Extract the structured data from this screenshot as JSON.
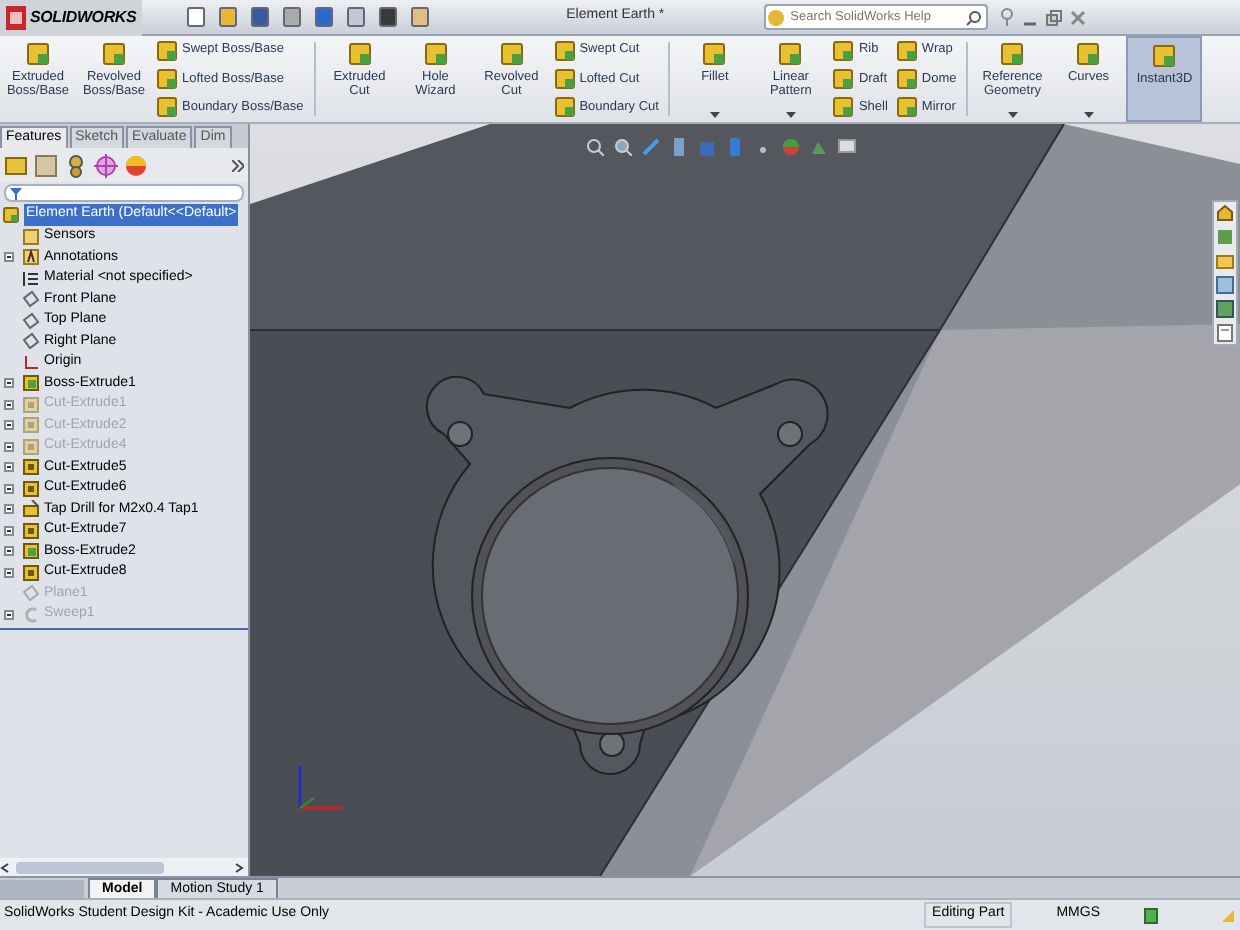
{
  "window": {
    "app": "SOLIDWORKS",
    "title": "Element Earth *"
  },
  "help_search": {
    "placeholder": "Search SolidWorks Help"
  },
  "ribbon": [
    {
      "kind": "large",
      "label": "Extruded Boss/Base"
    },
    {
      "kind": "large",
      "label": "Revolved Boss/Base"
    },
    {
      "kind": "stack",
      "items": [
        "Swept Boss/Base",
        "Lofted Boss/Base",
        "Boundary Boss/Base"
      ]
    },
    {
      "kind": "separator"
    },
    {
      "kind": "large",
      "label": "Extruded Cut"
    },
    {
      "kind": "large",
      "label": "Hole Wizard"
    },
    {
      "kind": "large",
      "label": "Revolved Cut"
    },
    {
      "kind": "stack",
      "items": [
        "Swept Cut",
        "Lofted Cut",
        "Boundary Cut"
      ]
    },
    {
      "kind": "separator"
    },
    {
      "kind": "large",
      "label": "Fillet",
      "dropdown": true
    },
    {
      "kind": "large",
      "label": "Linear Pattern",
      "dropdown": true
    },
    {
      "kind": "stack",
      "items": [
        "Rib",
        "Draft",
        "Shell"
      ]
    },
    {
      "kind": "stack",
      "items": [
        "Wrap",
        "Dome",
        "Mirror"
      ]
    },
    {
      "kind": "separator"
    },
    {
      "kind": "large",
      "label": "Reference Geometry",
      "dropdown": true
    },
    {
      "kind": "large",
      "label": "Curves",
      "dropdown": true
    },
    {
      "kind": "large",
      "label": "Instant3D",
      "selected": true
    }
  ],
  "tabs": [
    {
      "label": "Features",
      "selected": true
    },
    {
      "label": "Sketch",
      "selected": false
    },
    {
      "label": "Evaluate",
      "selected": false
    },
    {
      "label": "Dim",
      "selected": false
    }
  ],
  "tree": {
    "root": {
      "label": "Element Earth  (Default<<Default>",
      "selected": true
    },
    "items": [
      {
        "label": "Sensors",
        "kind": "sensor",
        "expandable": false,
        "suppressed": false
      },
      {
        "label": "Annotations",
        "kind": "annotation",
        "expandable": true,
        "suppressed": false
      },
      {
        "label": "Material <not specified>",
        "kind": "material",
        "expandable": false,
        "suppressed": false
      },
      {
        "label": "Front Plane",
        "kind": "plane",
        "expandable": false,
        "suppressed": false
      },
      {
        "label": "Top Plane",
        "kind": "plane",
        "expandable": false,
        "suppressed": false
      },
      {
        "label": "Right Plane",
        "kind": "plane",
        "expandable": false,
        "suppressed": false
      },
      {
        "label": "Origin",
        "kind": "origin",
        "expandable": false,
        "suppressed": false
      },
      {
        "label": "Boss-Extrude1",
        "kind": "boss",
        "expandable": true,
        "suppressed": false
      },
      {
        "label": "Cut-Extrude1",
        "kind": "cut",
        "expandable": true,
        "suppressed": true
      },
      {
        "label": "Cut-Extrude2",
        "kind": "cut",
        "expandable": true,
        "suppressed": true
      },
      {
        "label": "Cut-Extrude4",
        "kind": "cut",
        "expandable": true,
        "suppressed": true
      },
      {
        "label": "Cut-Extrude5",
        "kind": "cut",
        "expandable": true,
        "suppressed": false
      },
      {
        "label": "Cut-Extrude6",
        "kind": "cut",
        "expandable": true,
        "suppressed": false
      },
      {
        "label": "Tap Drill for M2x0.4 Tap1",
        "kind": "hole",
        "expandable": true,
        "suppressed": false
      },
      {
        "label": "Cut-Extrude7",
        "kind": "cut",
        "expandable": true,
        "suppressed": false
      },
      {
        "label": "Boss-Extrude2",
        "kind": "boss",
        "expandable": true,
        "suppressed": false
      },
      {
        "label": "Cut-Extrude8",
        "kind": "cut",
        "expandable": true,
        "suppressed": false
      },
      {
        "label": "Plane1",
        "kind": "plane",
        "expandable": false,
        "suppressed": true
      },
      {
        "label": "Sweep1",
        "kind": "sweep",
        "expandable": true,
        "suppressed": true
      }
    ]
  },
  "bottom_tabs": [
    {
      "label": "Model",
      "selected": true
    },
    {
      "label": "Motion Study 1",
      "selected": false
    }
  ],
  "status_bar": {
    "message": "SolidWorks Student Design Kit - Academic Use Only",
    "mode": "Editing Part",
    "units": "MMGS"
  }
}
